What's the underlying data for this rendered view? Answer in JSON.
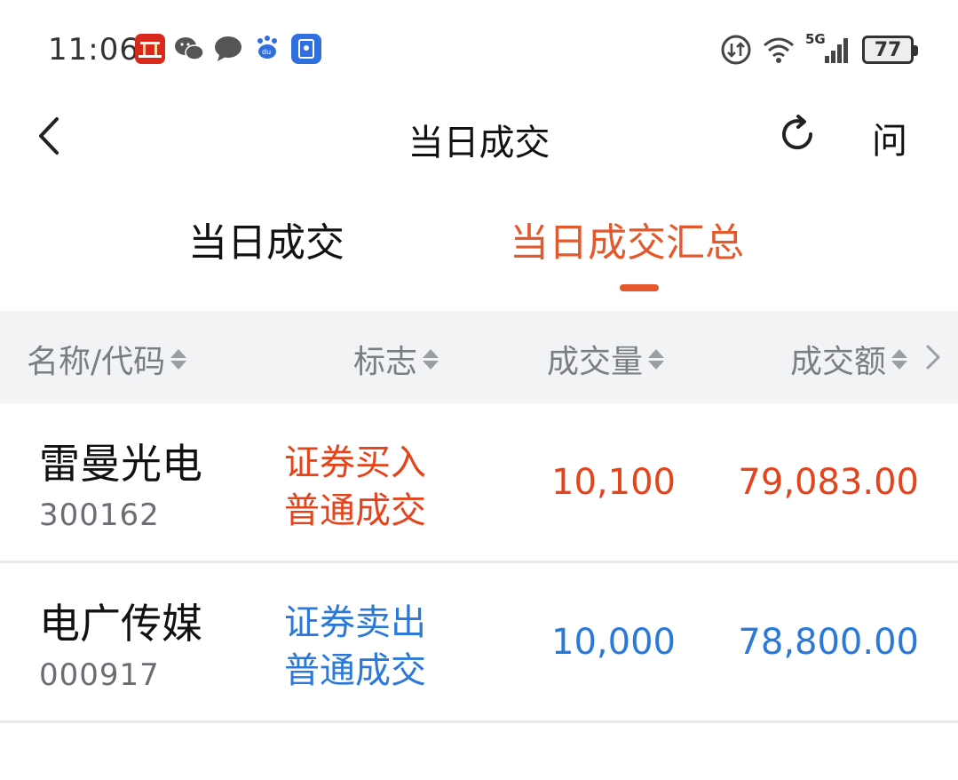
{
  "status_bar": {
    "time": "11:06",
    "network": "5G",
    "battery": "77",
    "app_icons": [
      "app-red-icon",
      "wechat-icon",
      "message-icon",
      "baidu-icon",
      "blue-app-icon"
    ]
  },
  "header": {
    "title": "当日成交",
    "ask_label": "问"
  },
  "tabs": [
    {
      "label": "当日成交",
      "active": false
    },
    {
      "label": "当日成交汇总",
      "active": true
    }
  ],
  "table": {
    "columns": [
      "名称/代码",
      "标志",
      "成交量",
      "成交额"
    ],
    "rows": [
      {
        "name": "雷曼光电",
        "code": "300162",
        "flag_line1": "证券买入",
        "flag_line2": "普通成交",
        "volume": "10,100",
        "amount": "79,083.00",
        "side": "buy"
      },
      {
        "name": "电广传媒",
        "code": "000917",
        "flag_line1": "证券卖出",
        "flag_line2": "普通成交",
        "volume": "10,000",
        "amount": "78,800.00",
        "side": "sell"
      }
    ]
  },
  "colors": {
    "accent": "#e4582b",
    "buy": "#e4431b",
    "sell": "#2a78d8",
    "header_bg": "#f2f3f5"
  }
}
